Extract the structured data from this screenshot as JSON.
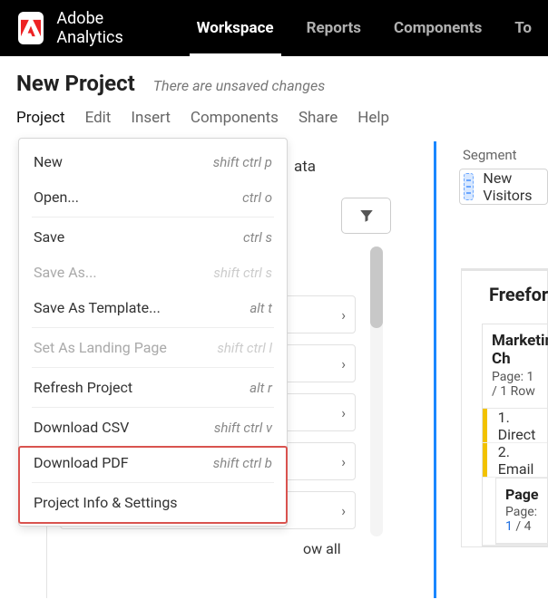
{
  "topbar": {
    "brand": "Adobe Analytics",
    "nav": [
      "Workspace",
      "Reports",
      "Components",
      "To"
    ],
    "active_index": 0
  },
  "header": {
    "title": "New Project",
    "unsaved": "There are unsaved changes",
    "menus": [
      "Project",
      "Edit",
      "Insert",
      "Components",
      "Share",
      "Help"
    ],
    "open_index": 0
  },
  "project_menu": [
    {
      "label": "New",
      "shortcut": "shift ctrl p",
      "disabled": false
    },
    {
      "label": "Open...",
      "shortcut": "ctrl o",
      "disabled": false
    },
    {
      "sep": true
    },
    {
      "label": "Save",
      "shortcut": "ctrl s",
      "disabled": false
    },
    {
      "label": "Save As...",
      "shortcut": "shift ctrl s",
      "disabled": true
    },
    {
      "label": "Save As Template...",
      "shortcut": "alt t",
      "disabled": false
    },
    {
      "sep": true
    },
    {
      "label": "Set As Landing Page",
      "shortcut": "shift ctrl l",
      "disabled": true
    },
    {
      "sep": true
    },
    {
      "label": "Refresh Project",
      "shortcut": "alt r",
      "disabled": false
    },
    {
      "sep": true
    },
    {
      "label": "Download CSV",
      "shortcut": "shift ctrl v",
      "disabled": false
    },
    {
      "label": "Download PDF",
      "shortcut": "shift ctrl b",
      "disabled": false
    },
    {
      "sep": true
    },
    {
      "label": "Project Info & Settings",
      "shortcut": "",
      "disabled": false
    }
  ],
  "leftpanel": {
    "partial_text": "ata",
    "show_all": "ow all"
  },
  "segment": {
    "label": "Segment",
    "value": "New Visitors"
  },
  "freeform": {
    "title": "Freeforn",
    "col_header": "Marketing Ch",
    "col_sub": "Page: 1 / 1 Row",
    "rows": [
      "1.  Direct",
      "2.  Email"
    ],
    "nested_header": "Page",
    "nested_sub_pre": "Page: ",
    "nested_sub_link": "1",
    "nested_sub_post": " / 4"
  }
}
